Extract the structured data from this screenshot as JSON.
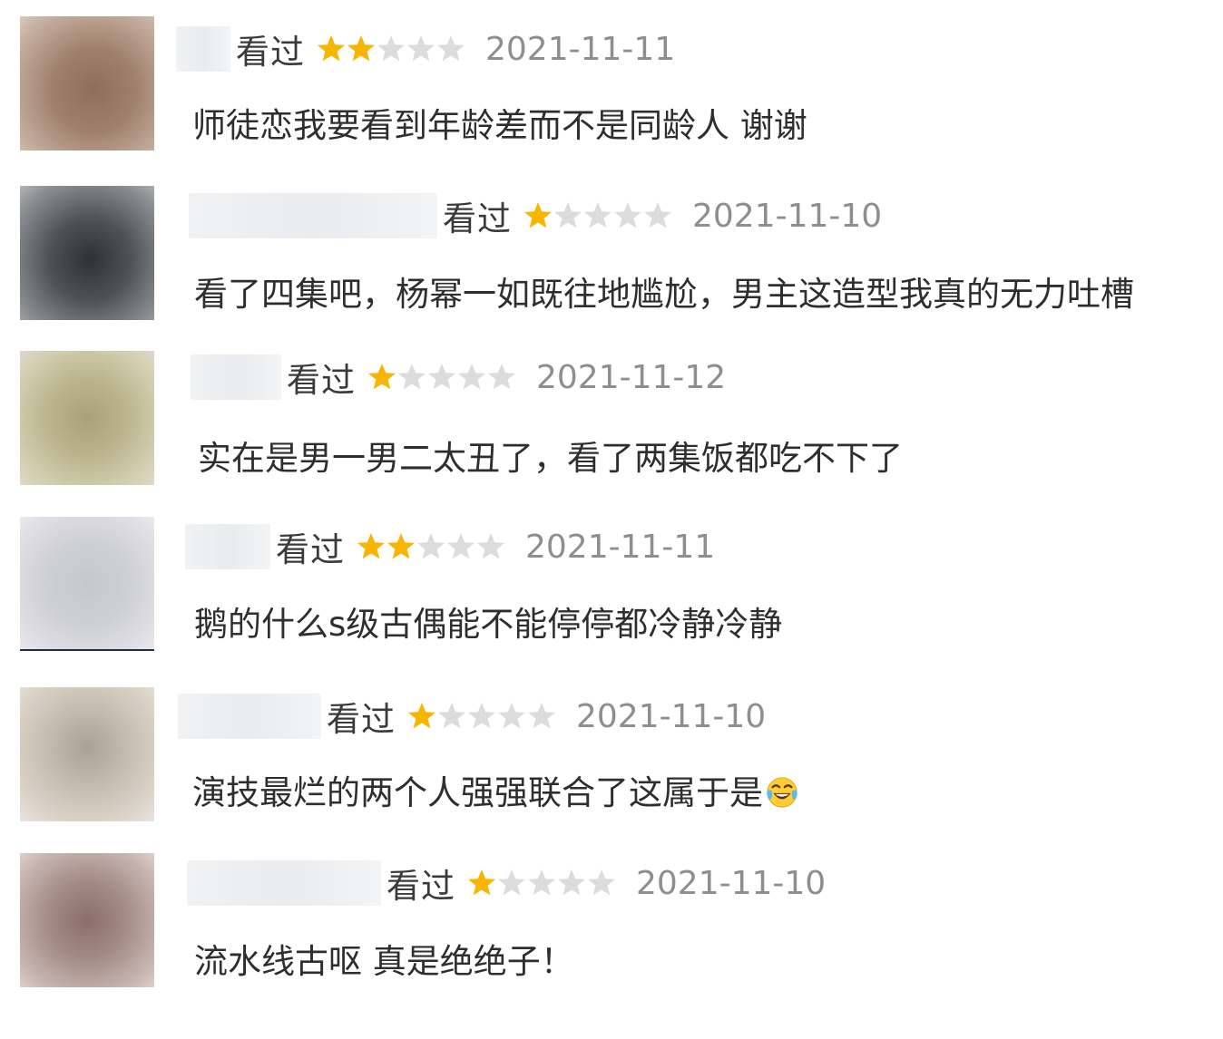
{
  "colors": {
    "star_on": "#f7b500",
    "star_off": "#dcdcdc",
    "date": "#8e8e8e",
    "text": "#2e2e2e"
  },
  "reviews": [
    {
      "status": "看过",
      "rating": 2,
      "max_rating": 5,
      "date": "2021-11-11",
      "comment": "师徒恋我要看到年龄差而不是同龄人 谢谢",
      "avatar_color": "#a0806c"
    },
    {
      "status": "看过",
      "rating": 1,
      "max_rating": 5,
      "date": "2021-11-10",
      "comment": "看了四集吧，杨幂一如既往地尴尬，男主这造型我真的无力吐槽",
      "avatar_color": "#4d5256"
    },
    {
      "status": "看过",
      "rating": 1,
      "max_rating": 5,
      "date": "2021-11-12",
      "comment": "实在是男一男二太丑了，看了两集饭都吃不下了",
      "avatar_color": "#b9b48c"
    },
    {
      "status": "看过",
      "rating": 2,
      "max_rating": 5,
      "date": "2021-11-11",
      "comment": "鹅的什么s级古偶能不能停停都冷静冷静",
      "avatar_color": "#cfcfd6"
    },
    {
      "status": "看过",
      "rating": 1,
      "max_rating": 5,
      "date": "2021-11-10",
      "comment": "演技最烂的两个人强强联合了这属于是",
      "emoji": "laughing-crying-emoji",
      "avatar_color": "#c4bcae"
    },
    {
      "status": "看过",
      "rating": 1,
      "max_rating": 5,
      "date": "2021-11-10",
      "comment": "流水线古呕 真是绝绝子！",
      "avatar_color": "#a38a86"
    }
  ]
}
